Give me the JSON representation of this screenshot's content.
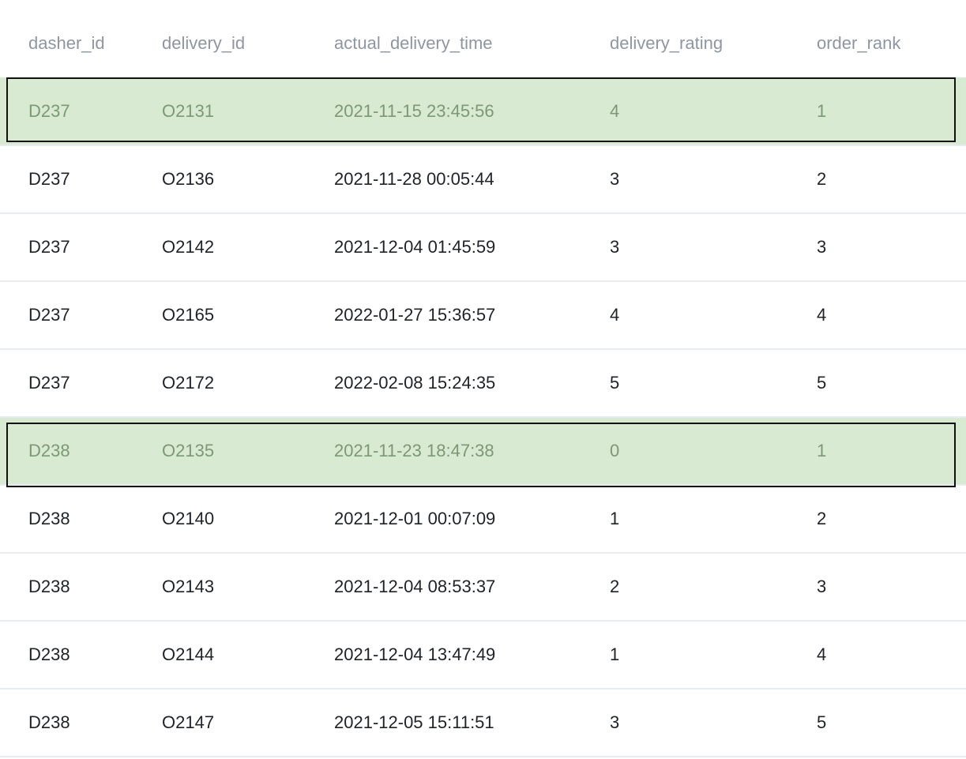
{
  "table": {
    "columns": [
      "dasher_id",
      "delivery_id",
      "actual_delivery_time",
      "delivery_rating",
      "order_rank"
    ],
    "rows": [
      {
        "cells": [
          "D237",
          "O2131",
          "2021-11-15 23:45:56",
          "4",
          "1"
        ],
        "highlighted": true
      },
      {
        "cells": [
          "D237",
          "O2136",
          "2021-11-28 00:05:44",
          "3",
          "2"
        ],
        "highlighted": false
      },
      {
        "cells": [
          "D237",
          "O2142",
          "2021-12-04 01:45:59",
          "3",
          "3"
        ],
        "highlighted": false
      },
      {
        "cells": [
          "D237",
          "O2165",
          "2022-01-27 15:36:57",
          "4",
          "4"
        ],
        "highlighted": false
      },
      {
        "cells": [
          "D237",
          "O2172",
          "2022-02-08 15:24:35",
          "5",
          "5"
        ],
        "highlighted": false
      },
      {
        "cells": [
          "D238",
          "O2135",
          "2021-11-23 18:47:38",
          "0",
          "1"
        ],
        "highlighted": true
      },
      {
        "cells": [
          "D238",
          "O2140",
          "2021-12-01 00:07:09",
          "1",
          "2"
        ],
        "highlighted": false
      },
      {
        "cells": [
          "D238",
          "O2143",
          "2021-12-04 08:53:37",
          "2",
          "3"
        ],
        "highlighted": false
      },
      {
        "cells": [
          "D238",
          "O2144",
          "2021-12-04 13:47:49",
          "1",
          "4"
        ],
        "highlighted": false
      },
      {
        "cells": [
          "D238",
          "O2147",
          "2021-12-05 15:11:51",
          "3",
          "5"
        ],
        "highlighted": false
      }
    ]
  },
  "colors": {
    "header_text": "#8e96a3",
    "row_divider": "#e7ecf2",
    "highlight_fill": "#d9ead3",
    "highlight_text": "#7d9874",
    "highlight_border": "#111111"
  }
}
